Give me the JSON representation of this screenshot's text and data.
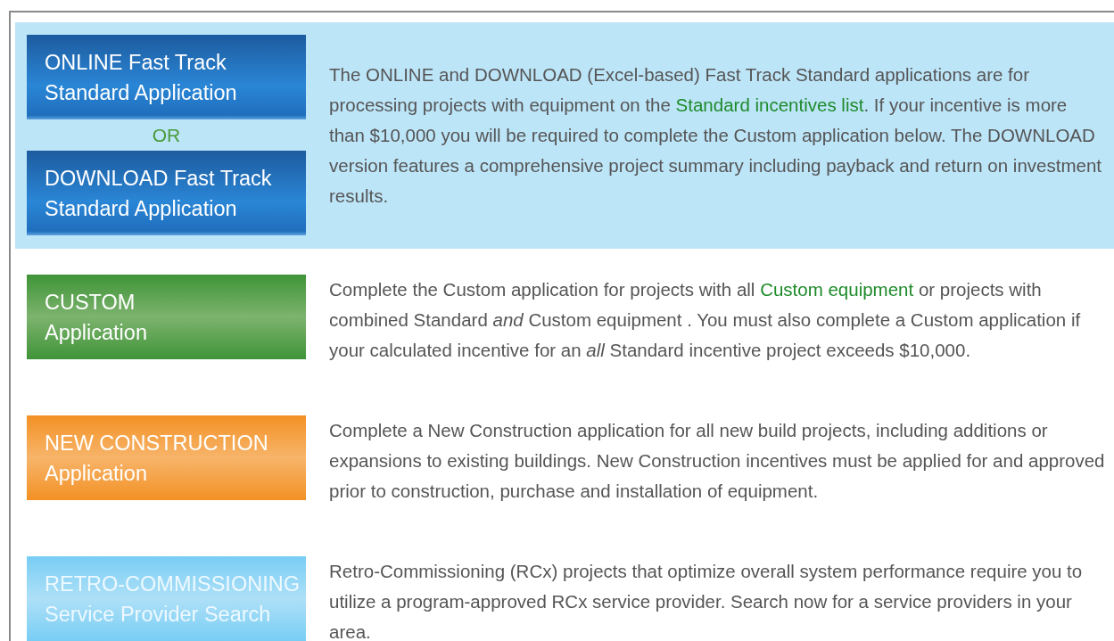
{
  "sections": [
    {
      "highlight": true,
      "buttons": [
        {
          "kind": "blue",
          "lines": [
            "ONLINE Fast Track",
            "Standard Application"
          ]
        },
        {
          "kind": "blue",
          "lines": [
            "DOWNLOAD Fast Track",
            "Standard Application"
          ]
        }
      ],
      "separator": "OR",
      "description": [
        {
          "kind": "text",
          "text": "The ONLINE and DOWNLOAD (Excel-based) Fast Track Standard applications are for processing projects with equipment on the "
        },
        {
          "kind": "link",
          "text": "Standard incentives list"
        },
        {
          "kind": "text",
          "text": ". If your incentive is more than $10,000 you will be required to complete the Custom application below. The DOWNLOAD version features a comprehensive project summary including payback and return on investment results."
        }
      ]
    },
    {
      "highlight": false,
      "buttons": [
        {
          "kind": "green",
          "lines": [
            "CUSTOM",
            "Application"
          ]
        }
      ],
      "description": [
        {
          "kind": "text",
          "text": "Complete the Custom application for projects with all "
        },
        {
          "kind": "link",
          "text": "Custom equipment"
        },
        {
          "kind": "text",
          "text": " or projects with combined Standard *and* Custom equipment . You must also complete a Custom application if your calculated incentive for an *all* Standard incentive project exceeds $10,000."
        }
      ]
    },
    {
      "highlight": false,
      "buttons": [
        {
          "kind": "orange",
          "lines": [
            "NEW CONSTRUCTION",
            "Application"
          ]
        }
      ],
      "description": [
        {
          "kind": "text",
          "text": "Complete a New Construction application for all new build projects, including additions or expansions to existing buildings. New Construction incentives must be applied for and approved prior to construction, purchase and installation of equipment."
        }
      ]
    },
    {
      "highlight": false,
      "buttons": [
        {
          "kind": "sky",
          "lines": [
            "RETRO-COMMISSIONING",
            "Service Provider Search"
          ]
        }
      ],
      "description": [
        {
          "kind": "text",
          "text": "Retro-Commissioning (RCx) projects that optimize overall system performance require you to utilize a program-approved RCx service provider. Search now for a service providers in your area."
        }
      ]
    }
  ]
}
